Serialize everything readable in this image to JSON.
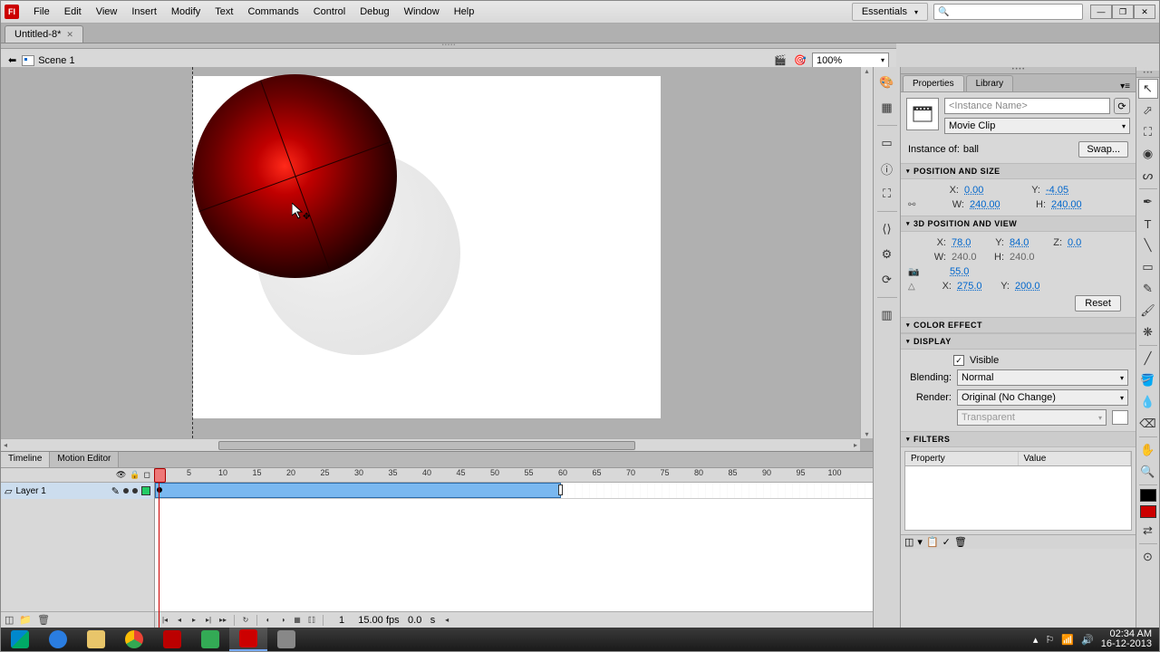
{
  "menu": {
    "items": [
      "File",
      "Edit",
      "View",
      "Insert",
      "Modify",
      "Text",
      "Commands",
      "Control",
      "Debug",
      "Window",
      "Help"
    ],
    "workspace": "Essentials"
  },
  "doc": {
    "tab": "Untitled-8*"
  },
  "editbar": {
    "scene": "Scene 1",
    "zoom": "100%"
  },
  "timeline": {
    "tabs": [
      "Timeline",
      "Motion Editor"
    ],
    "layer": "Layer 1",
    "ticks": [
      5,
      10,
      15,
      20,
      25,
      30,
      35,
      40,
      45,
      50,
      55,
      60,
      65,
      70,
      75,
      80,
      85,
      90,
      95,
      100
    ],
    "status": {
      "frame": "1",
      "fps": "15.00",
      "fps_lbl": "fps",
      "time": "0.0",
      "time_unit": "s"
    }
  },
  "panels": {
    "tabs": [
      "Properties",
      "Library"
    ],
    "instance_placeholder": "<Instance Name>",
    "symbol_type": "Movie Clip",
    "instance_of_lbl": "Instance of:",
    "instance_of": "ball",
    "swap": "Swap...",
    "sections": {
      "possize": "POSITION AND SIZE",
      "threed": "3D POSITION AND VIEW",
      "color": "COLOR EFFECT",
      "display": "DISPLAY",
      "filters": "FILTERS"
    },
    "pos": {
      "x_lbl": "X:",
      "x": "0.00",
      "y_lbl": "Y:",
      "y": "-4.05",
      "w_lbl": "W:",
      "w": "240.00",
      "h_lbl": "H:",
      "h": "240.00"
    },
    "threed": {
      "x_lbl": "X:",
      "x": "78.0",
      "y_lbl": "Y:",
      "y": "84.0",
      "z_lbl": "Z:",
      "z": "0.0",
      "w_lbl": "W:",
      "w": "240.0",
      "h_lbl": "H:",
      "h": "240.0",
      "persp": "55.0",
      "vx_lbl": "X:",
      "vx": "275.0",
      "vy_lbl": "Y:",
      "vy": "200.0",
      "reset": "Reset"
    },
    "display": {
      "visible": "Visible",
      "blend_lbl": "Blending:",
      "blend": "Normal",
      "render_lbl": "Render:",
      "render": "Original (No Change)",
      "transparent": "Transparent"
    },
    "filters": {
      "col1": "Property",
      "col2": "Value"
    }
  },
  "taskbar": {
    "time": "02:34 AM",
    "date": "16-12-2013"
  }
}
